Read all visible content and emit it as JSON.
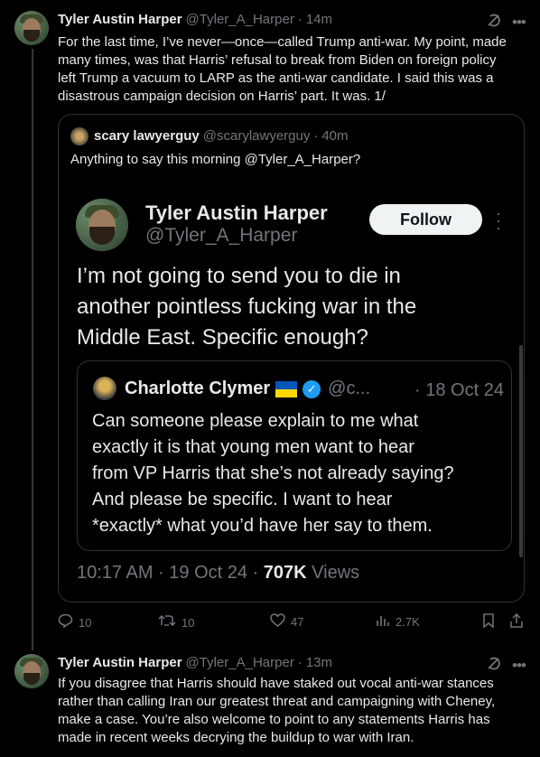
{
  "tweet1": {
    "name": "Tyler Austin Harper",
    "handle": "@Tyler_A_Harper",
    "time": "14m",
    "text_lines": [
      "For the last time, I’ve never—once—called Trump anti-war. My point, made",
      "many times, was that Harris’ refusal to break from Biden on foreign policy",
      "left Trump a vacuum to LARP as the anti-war candidate. I said this was a",
      "disastrous campaign decision on Harris’ part. It was. 1/"
    ],
    "quote": {
      "name": "scary lawyerguy",
      "handle": "@scarylawyerguy",
      "time": "40m",
      "text": "Anything to say this morning @Tyler_A_Harper?",
      "screenshot": {
        "name": "Tyler Austin Harper",
        "handle": "@Tyler_A_Harper",
        "follow_label": "Follow",
        "text_lines": [
          "I’m not going to send you to die in",
          "another pointless fucking war in the",
          "Middle East. Specific enough?"
        ],
        "inner_quote": {
          "name": "Charlotte Clymer",
          "handle": "@c...",
          "time": "· 18 Oct 24",
          "text_lines": [
            "Can someone please explain to me what",
            "exactly it is that young men want to hear",
            "from VP Harris that she’s not already saying?",
            "And please be specific. I want to hear",
            "*exactly* what you’d have her say to them."
          ]
        },
        "meta_time": "10:17 AM · 19 Oct 24 · ",
        "views_count": "707K",
        "views_label": " Views"
      }
    },
    "actions": {
      "replies": "10",
      "retweets": "10",
      "likes": "47",
      "views": "2.7K"
    }
  },
  "tweet2": {
    "name": "Tyler Austin Harper",
    "handle": "@Tyler_A_Harper",
    "time": "13m",
    "text_lines": [
      "If you disagree that Harris should have staked out vocal anti-war stances",
      "rather than calling Iran our greatest threat and campaigning with Cheney,",
      "make a case. You’re also welcome to point to any statements Harris has",
      "made in recent weeks decrying the buildup to war with Iran."
    ]
  },
  "icons": [
    "grok-icon",
    "more-icon",
    "reply-icon",
    "retweet-icon",
    "like-icon",
    "views-icon",
    "bookmark-icon",
    "share-icon",
    "verified-icon",
    "ukraine-flag-icon"
  ],
  "colors": {
    "background": "#000000",
    "text": "#e7e9ea",
    "muted": "#71767b",
    "border": "#2f3336",
    "verified": "#1d9bf0"
  }
}
